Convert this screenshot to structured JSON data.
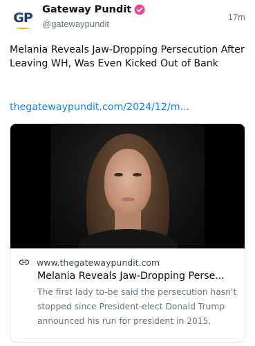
{
  "post": {
    "author": {
      "avatar_text": "GP",
      "display_name": "Gateway Pundit",
      "handle": "@gatewaypundit",
      "verified_icon": "verified-badge-icon"
    },
    "timestamp": "17m",
    "text": "Melania Reveals Jaw-Dropping Persecution After Leaving WH, Was Even Kicked Out of Bank",
    "link_text": "thegatewaypundit.com/2024/12/m...",
    "card": {
      "image_alt": "Portrait of Melania Trump",
      "domain_icon": "link-icon",
      "domain": "www.thegatewaypundit.com",
      "title": "Melania Reveals Jaw-Dropping Perse...",
      "description": "The first lady to-be said the persecution hasn't stopped since President-elect Donald Trump announced his run for president in 2015."
    }
  },
  "colors": {
    "link": "#1083fe",
    "muted": "#687684",
    "verified_badge": "#ec4899",
    "card_border": "#dfe3e8"
  }
}
